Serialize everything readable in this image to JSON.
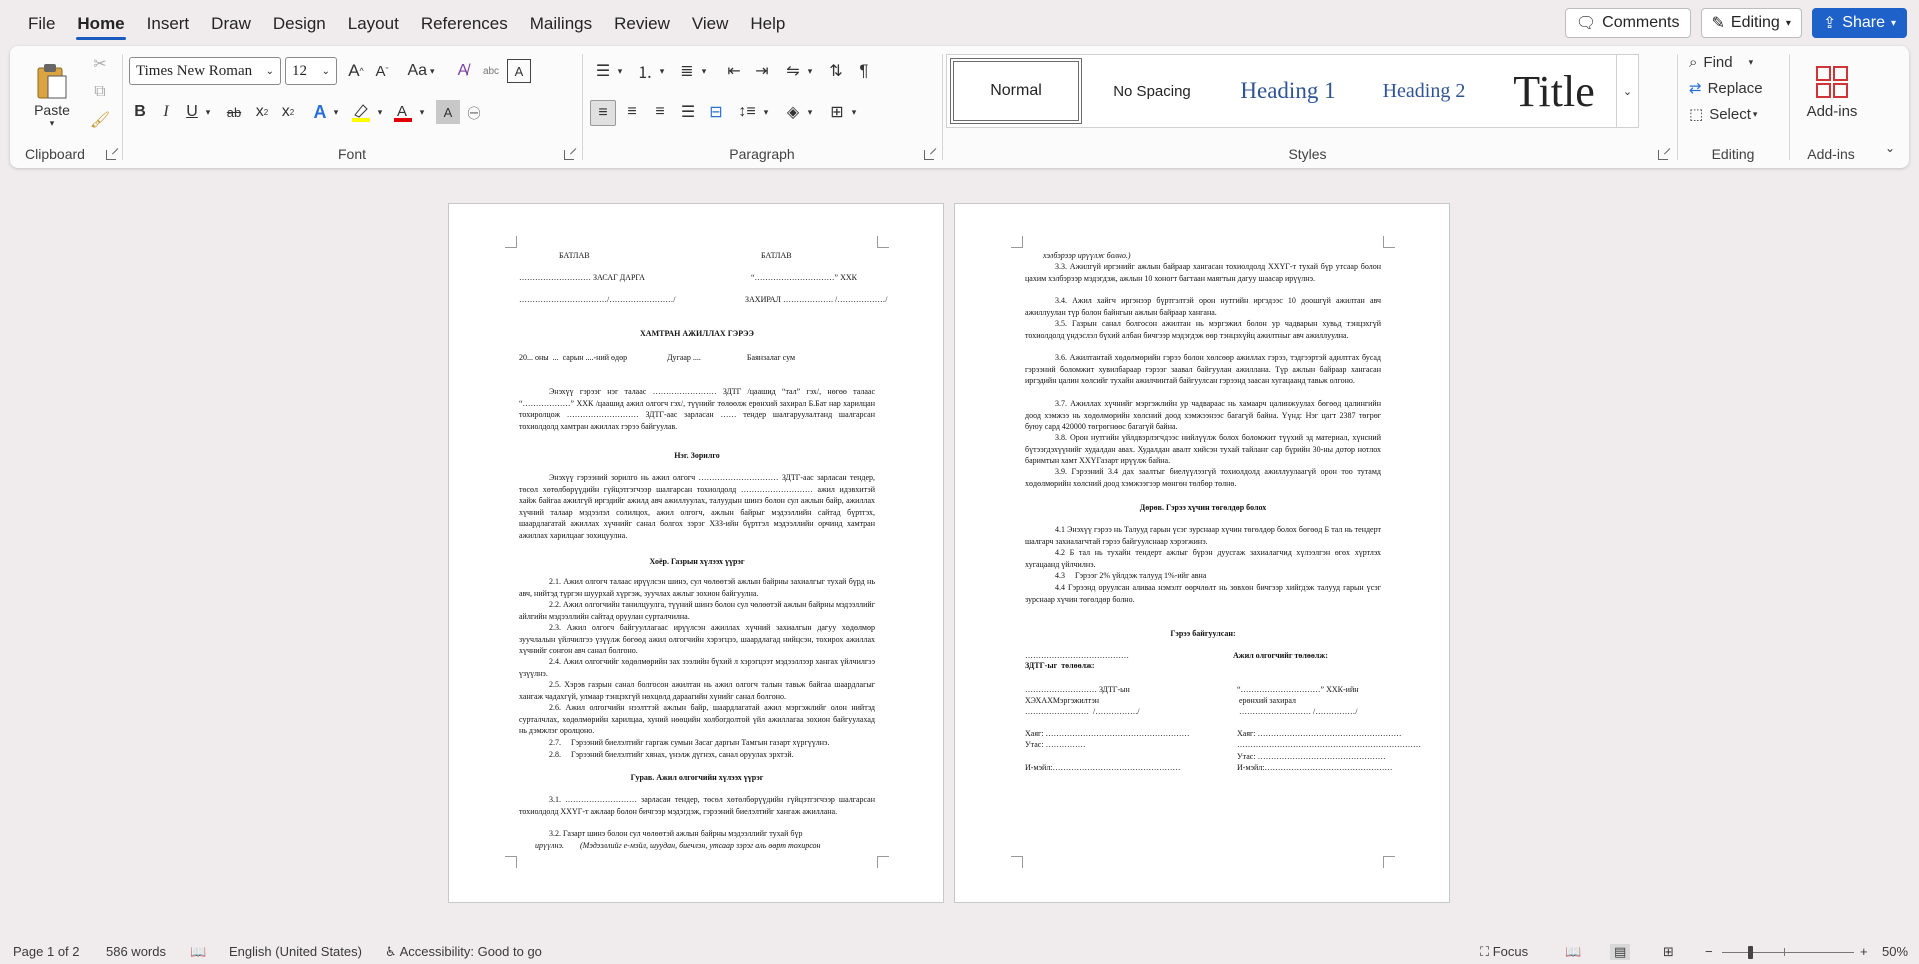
{
  "menu": {
    "tabs": [
      "File",
      "Home",
      "Insert",
      "Draw",
      "Design",
      "Layout",
      "References",
      "Mailings",
      "Review",
      "View",
      "Help"
    ],
    "active": "Home",
    "comments_label": "Comments",
    "editing_label": "Editing",
    "share_label": "Share"
  },
  "ribbon": {
    "clipboard": {
      "paste_label": "Paste",
      "group_label": "Clipboard"
    },
    "font": {
      "font_name": "Times New Roman",
      "font_size": "12",
      "change_case": "Aa",
      "group_label": "Font"
    },
    "paragraph": {
      "group_label": "Paragraph"
    },
    "styles": {
      "items": [
        "Normal",
        "No Spacing",
        "Heading 1",
        "Heading 2",
        "Title"
      ],
      "group_label": "Styles"
    },
    "editing": {
      "find_label": "Find",
      "replace_label": "Replace",
      "select_label": "Select",
      "group_label": "Editing"
    },
    "addins": {
      "label": "Add-ins",
      "group_label": "Add-ins"
    }
  },
  "page1": {
    "approve_left": "БАТЛАВ",
    "approve_right": "БАТЛАВ",
    "line_gov": "……………………… ЗАСАГ ДАРГА",
    "line_xxk": "“…………………………” ХХК",
    "line_sign_left": "……………………………/……………………/",
    "line_director": "ЗАХИРАЛ ………………. /………………/",
    "title": "ХАМТРАН АЖИЛЛАХ ГЭРЭЭ",
    "date_line": "20... оны  ...  сарын ....-ний өдөр                    Дугаар ....                       Баянзалаг сум",
    "intro": "Энэхүү гэрээг нэг талаас …………………… ЗДТГ /цаашид “тал” гэх/, нөгөө талаас “………………” ХХК /цаашид ажил олгогч гэх/, түүнийг төлөөлж ерөнхий захирал Б.Бат нар харилцан тохиролцож ……………………… ЗДТГ-аас зарласан …… тендер шалгаруулалтанд шалгарсан тохиолдолд хамтран ажиллах гэрээ байгуулав.",
    "sec1": "Нэг. Зорилго",
    "sec1_text": "Энэхүү гэрээний зорилго нь ажил олгогч ………………………… ЗДТГ-аас зарласан тендер, төсөл хөтөлбөрүүдийн гүйцэтгэгчээр шалгарсан тохиолдолд ……………………… ажил идэвхитэй хайж байгаа ажилгүй иргэдийг ажилд авч ажиллуулах, талуудын шинэ болон сул ажлын байр, ажиллах хүчний талаар мэдээлэл солилцох, ажил олгогч, ажлын байрыг мэдээллийн сайтад бүртгэх, шаардлагатай ажиллах хүчнийг санал болгох зэрэг ХЗЗ-ийн бүртгэл мэдээллийн орчинд хамтран ажиллах харилцааг зохицуулна.",
    "sec2": "Хоёр. Газрын хүлээх үүрэг",
    "sec2_items": [
      "2.1.     Ажил олгогч талаас ирүүлсэн шинэ, сул чөлөөтэй ажлын байрны захиалгыг тухай бүрд нь авч, нийтэд түргэн шуурхай хүргэж, зуучлах ажлыг зохион байгуулна.",
      "2.2.     Ажил олгогчийн танилцуулга, түүний шинэ болон сул чөлөөтэй ажлын байрны мэдээллийг айлгийн мэдээллийн сайтад оруулан сурталчилна.",
      "2.3.     Ажил олгогч байгууллагаас ирүүлсэн ажиллах хүчний захиалгын дагуу хөдөлмөр зуучлалын үйлчилгээ үзүүлж бөгөөд ажил олгогчийн хэрэгцээ, шаардлагад нийцсэн, тохирох ажиллах хүчнийг сонгон авч санал болгоно.",
      "2.4.     Ажил олгогчийг хөдөлмөрийн зах зээлийн бүхий л хэрэгцээт мэдээллээр хангах үйлчилгээ үзүүлнэ.",
      "2.5.     Хэрэв газрын санал болгосон ажилтан нь ажил олгогч талын тавьж байгаа шаардлагыг хангаж чадахгүй, улмаар тэнцэхгүй нөхцөлд дараагийн хүнийг санал болгоно.",
      "2.6.     Ажил олгогчийн нээлттэй ажлын байр, шаардлагатай ажил мэргэжлийг олон нийтэд сурталчлах, хөдөлмөрийн харилцаа, хуний нөөцийн холбогдолтой үйл ажиллагаа зохион байгуулахад нь дэмжлэг оролцоно.",
      "2.7.     Гэрээний биелэлтийг гаргаж сумын Засаг даргын Тамгын газарт хүргүүлнэ.",
      "2.8.     Гэрээний биелэлтийг хянах, үнэлж дүгнэх, санал оруулах эрхтэй."
    ],
    "sec3": "Гурав. Ажил олгогчийн хүлээх үүрэг",
    "sec3_items": [
      "3.1.     ……………………… зарласан тендер, төсөл хөтөлбөрүүдийн гүйцэтгэгчээр шалгарсан тохиолдолд ХХҮГ-т ажлаар болон бичгээр мэдэгдэж, гэрээний биелэлтийг хангаж ажиллана.",
      "3.2.     Газарт шинэ болон сул чөлөөтэй ажлын байрны мэдээллийг тухай бүр"
    ],
    "last_line": "ирүүлнэ.        (Мэдээллийг е-мэйл, шуудан, биечлэн, утсаар зэрэг аль өөрт тохирсон"
  },
  "page2": {
    "first_line": "хэлбэрээр ирүүлж болно.)",
    "items": [
      "3.3.     Ажилгүй иргэнийг ажлын байраар хангасан тохиолдолд ХХҮГ-т тухай бүр утсаар болон цахим хэлбэрээр мэдэгдэж, ажлын 10 хоногт багтаан маягтын дагуу шаасар ирүүлнэ.",
      "3.4.     Ажил хайгч иргэнээр бүртгэлтэй орон нутгийн иргэдээс 10 доошгүй ажилтан авч ажиллуулан түр болон байнгын ажлын байраар хангана.",
      "3.5.     Газрын санал болгосон ажилтан нь мэргэжил болон ур чадварын хувьд тэнцэхгүй тохиолдолд үндэслэл бүхий албан бичгээр мэдэгдэж өөр тэнцэхүйц ажилтныг авч ажиллуулна.",
      "3.6.     Ажилтантай хөдөлмөрийн гэрээ болон хөлсөөр ажиллах гэрээ, тэдгээртэй адилтгах бусад гэрээний боломжит хувилбараар гэрээг заавал байгуулан ажиллана. Түр ажлын байраар хангасан иргэдийн цалин хөлсийг тухайн ажилчинтай байгуулсан гэрээнд заасан хугацаанд тавьж олгоно.",
      "3.7.     Ажиллах хүчнийг мэргэжлийн ур чадвараас нь хамаарч цалинжуулах бөгөөд цалингийн доод хэмжээ нь хөдөлмөрийн хөлсний доод хэмжээнээс багагүй байна. Үүнд: Нэг цагт 2387 төгрөг буюу сард 420000 төгрөгнөөс багагүй байна.",
      "3.8.     Орон нутгийн үйлдвэрлэгчдээс нийлүүлж болох боломжит түүхий эд материал, хүнсний бүтээгдэхүүнийг худалдан авах. Худалдан авалт хийсэн тухай тайланг сар бүрийн 30-ны дотор нотлох баримтын хамт ХХҮГазарт ирүүлж байна.",
      "3.9.     Гэрээний 3.4 дах заалтыг биелүүлээгүй тохиолдолд ажиллуулаагүй орон тоо тутамд хөдөлмөрийн хөлсний доод хэмжээгээр мөнгөн төлбөр төлнө."
    ],
    "sec4": "Дөрөв. Гэрээ хүчин төгөлдөр болох",
    "sec4_items": [
      "4.1     Энэхүү гэрээ нь Талууд гарын үсэг зурснаар хүчин төгөлдөр болох бөгөөд Б тал нь тендерт шалгарч захиалагчтай гэрээ байгуулснаар хэрэгжинэ.",
      "4.2     Б тал нь тухайн тендерт ажлыг бүрэн дуусгаж захиалагчид хүлээлгэн өгөх хүртлэх хугацаанд үйлчилнэ.",
      "4.3     Гэрээг 2% үйлдэж талууд 1%-ийг авна",
      "4.4     Гэрээнд оруулсан аливаа нэмэлт өөрчлөлт нь зөвхөн бичгээр хийгдэж талууд гарын үсэг зурснаар хүчин төгөлдөр болно."
    ],
    "sig_title": "Гэрээ байгуулсан:",
    "sig_left_dots": "…………………………………",
    "sig_right_head": "Ажил олгогчийг төлөөлж:",
    "sig_left_head": "ЗДТГ-ыг  төлөөлж:",
    "sig_left_1": "……………………… ЗДТГ-ын",
    "sig_left_2": "ХЭХАХМэргэжилтэн",
    "sig_left_3": "……………………  /……………./",
    "sig_right_1": "“…………………………” ХХК-ийн",
    "sig_right_2": "ерөнхий захирал",
    "sig_right_3": "……………………… /……………/",
    "addr_left": "Хаяг: ………………………………………………",
    "phone_left": "Утас: ……………",
    "email_left": "И-мэйл:…………………………………………",
    "addr_right": "Хаяг: ………………………………………………",
    "addr_right_2": "……………………………………………………………",
    "phone_right": "Утас: …………………………………………",
    "email_right": "И-мэйл:…………………………………………"
  },
  "status": {
    "page": "Page 1 of 2",
    "words": "586 words",
    "language": "English (United States)",
    "accessibility": "Accessibility: Good to go",
    "focus": "Focus",
    "zoom": "50%"
  },
  "colors": {
    "accent": "#185abd",
    "share_bg": "#1e61c9",
    "heading": "#2f5496",
    "highlight": "#ffff00",
    "font_color": "#e00000"
  }
}
